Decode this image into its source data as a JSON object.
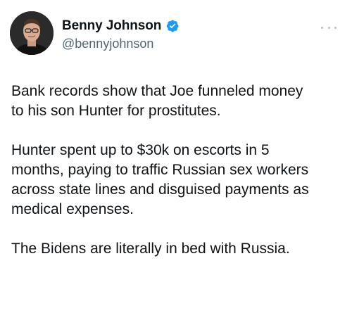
{
  "author": {
    "display_name": "Benny Johnson",
    "handle": "@bennyjohnson",
    "verified": true,
    "verified_color": "#1d9bf0"
  },
  "more_icon": "more-horizontal-icon",
  "tweet": {
    "paragraphs": [
      "Bank records show that Joe funneled money\nto his son Hunter for prostitutes.",
      "Hunter spent up to $30k on escorts in 5\nmonths, paying to traffic Russian sex workers\nacross state lines and disguised payments as\nmedical expenses.",
      "The Bidens are literally in bed with Russia."
    ]
  }
}
